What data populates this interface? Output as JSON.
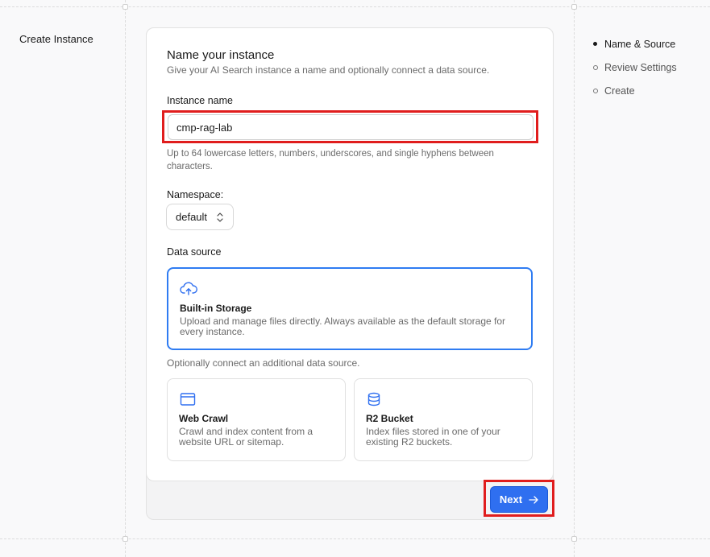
{
  "page": {
    "title": "Create Instance"
  },
  "stepper": {
    "steps": [
      {
        "label": "Name & Source",
        "active": true
      },
      {
        "label": "Review Settings",
        "active": false
      },
      {
        "label": "Create",
        "active": false
      }
    ]
  },
  "form": {
    "heading": "Name your instance",
    "subheading": "Give your AI Search instance a name and optionally connect a data source.",
    "instance_name": {
      "label": "Instance name",
      "value": "cmp-rag-lab",
      "help": "Up to 64 lowercase letters, numbers, underscores, and single hyphens between characters."
    },
    "namespace": {
      "label": "Namespace:",
      "value": "default"
    },
    "data_source": {
      "label": "Data source",
      "builtin": {
        "title": "Built-in Storage",
        "description": "Upload and manage files directly. Always available as the default storage for every instance.",
        "icon": "cloud-upload-icon"
      },
      "optional_note": "Optionally connect an additional data source.",
      "options": [
        {
          "title": "Web Crawl",
          "description": "Crawl and index content from a website URL or sitemap.",
          "icon": "browser-window-icon"
        },
        {
          "title": "R2 Bucket",
          "description": "Index files stored in one of your existing R2 buckets.",
          "icon": "database-icon"
        }
      ]
    }
  },
  "actions": {
    "next_label": "Next",
    "next_icon": "arrow-right-icon"
  },
  "colors": {
    "accent": "#2f6ff0",
    "selected_border": "#2f7cf2",
    "highlight": "#e01d1d"
  }
}
